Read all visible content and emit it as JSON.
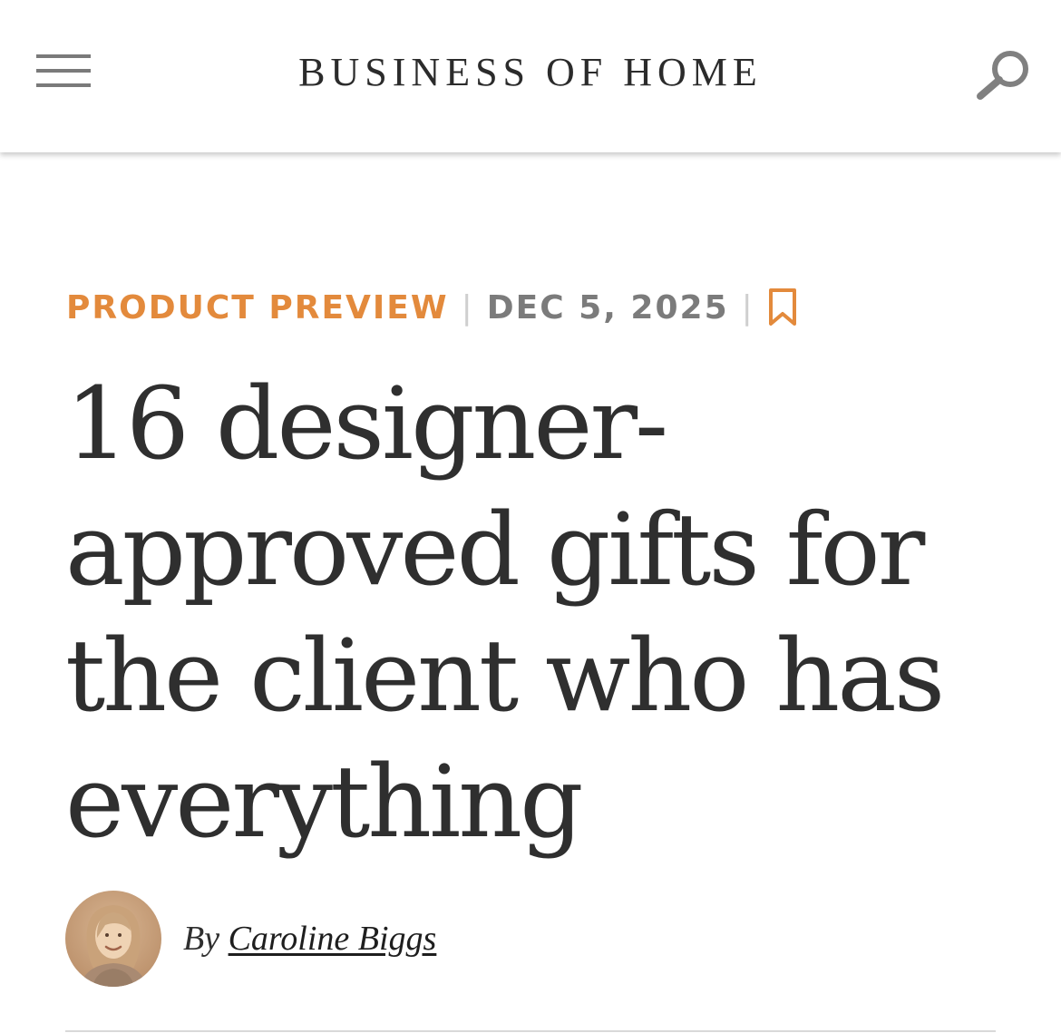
{
  "header": {
    "logo": "BUSINESS OF HOME",
    "menu_icon": "hamburger-menu-icon",
    "search_icon": "search-icon"
  },
  "article": {
    "category": "PRODUCT PREVIEW",
    "date": "DEC 5, 2025",
    "separator": "|",
    "bookmark_icon": "bookmark-icon",
    "headline": "16 designer-approved gifts for the client who has everything",
    "byline_prefix": "By",
    "author": "Caroline Biggs"
  },
  "colors": {
    "accent": "#e38a3c",
    "date": "#7b7b7b",
    "text": "#2f2f2f",
    "icon_gray": "#7a7a7a"
  }
}
